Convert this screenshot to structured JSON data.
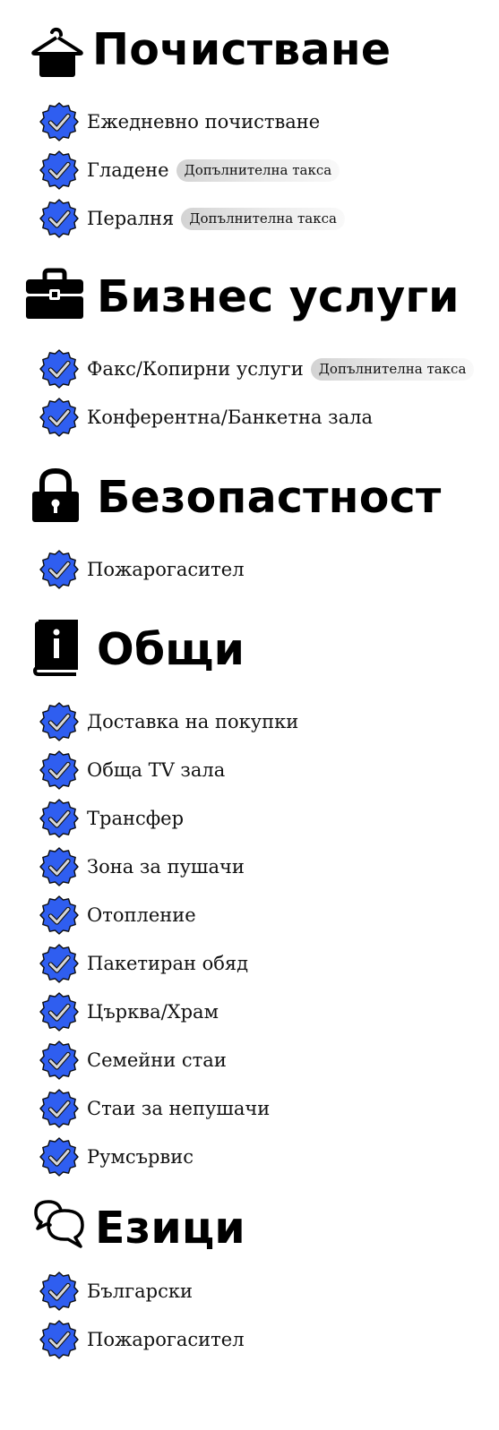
{
  "sections": [
    {
      "title": "Почистване",
      "icon": "hanger-icon",
      "items": [
        {
          "label": "Ежедневно почистване"
        },
        {
          "label": "Гладене",
          "fee": "Допълнителна такса"
        },
        {
          "label": "Пералня",
          "fee": "Допълнителна такса"
        }
      ]
    },
    {
      "title": "Бизнес услуги",
      "icon": "briefcase-icon",
      "items": [
        {
          "label": "Факс/Копирни услуги",
          "fee": "Допълнителна такса"
        },
        {
          "label": "Конферентна/Банкетна зала"
        }
      ]
    },
    {
      "title": "Безопастност",
      "icon": "lock-icon",
      "items": [
        {
          "label": "Пожарогасител"
        }
      ]
    },
    {
      "title": "Общи",
      "icon": "info-book-icon",
      "items": [
        {
          "label": "Доставка на покупки"
        },
        {
          "label": "Обща TV зала"
        },
        {
          "label": "Трансфер"
        },
        {
          "label": "Зона за пушачи"
        },
        {
          "label": "Отопление"
        },
        {
          "label": "Пакетиран обяд"
        },
        {
          "label": "Църква/Храм"
        },
        {
          "label": "Семейни стаи"
        },
        {
          "label": "Стаи за непушачи"
        },
        {
          "label": "Румсървис"
        }
      ]
    },
    {
      "title": "Езици",
      "icon": "chat-bubbles-icon",
      "items": [
        {
          "label": "Български"
        },
        {
          "label": "Пожарогасител"
        }
      ]
    }
  ],
  "colors": {
    "badge_fill": "#2f5ef0",
    "badge_check": "#d7d7d7",
    "title": "#000000",
    "text": "#111111"
  }
}
